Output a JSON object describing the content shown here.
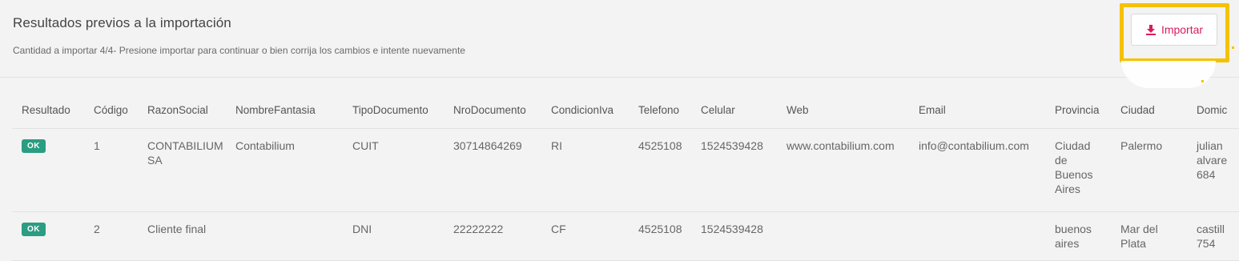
{
  "header": {
    "title": "Resultados previos a la importación",
    "subtitle": "Cantidad a importar 4/4- Presione importar para continuar o bien corrija los cambios e intente nuevamente",
    "import_button": "Importar",
    "import_icon": "download-icon"
  },
  "table": {
    "columns": [
      "Resultado",
      "Código",
      "RazonSocial",
      "NombreFantasia",
      "TipoDocumento",
      "NroDocumento",
      "CondicionIva",
      "Telefono",
      "Celular",
      "Web",
      "Email",
      "Provincia",
      "Ciudad",
      "Domic"
    ],
    "rows": [
      {
        "resultado": "OK",
        "codigo": "1",
        "razon_social": [
          "CONTABILIUM",
          "SA"
        ],
        "nombre_fantasia": "Contabilium",
        "tipo_documento": "CUIT",
        "nro_documento": "30714864269",
        "condicion_iva": "RI",
        "telefono": "4525108",
        "celular": "1524539428",
        "web": "www.contabilium.com",
        "email": "info@contabilium.com",
        "provincia": [
          "Ciudad",
          "de",
          "Buenos",
          "Aires"
        ],
        "ciudad": "Palermo",
        "domicilio": [
          "julian",
          "alvare",
          "684"
        ]
      },
      {
        "resultado": "OK",
        "codigo": "2",
        "razon_social": [
          "Cliente final"
        ],
        "nombre_fantasia": "",
        "tipo_documento": "DNI",
        "nro_documento": "22222222",
        "condicion_iva": "CF",
        "telefono": "4525108",
        "celular": "1524539428",
        "web": "",
        "email": "",
        "provincia": [
          "buenos",
          "aires"
        ],
        "ciudad": [
          "Mar del",
          "Plata"
        ],
        "domicilio": [
          "castill",
          "754"
        ]
      }
    ]
  },
  "colors": {
    "accent": "#d81b60",
    "highlight": "#f5c200",
    "ok_badge": "#2a9d82"
  }
}
